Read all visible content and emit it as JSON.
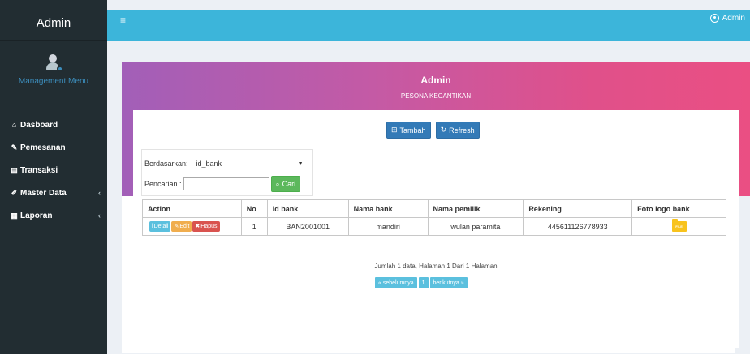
{
  "sidebar": {
    "brand": "Admin",
    "management_label": "Management Menu",
    "items": [
      {
        "icon": "home-icon",
        "glyph": "⌂",
        "label": "Dasboard",
        "chevron": ""
      },
      {
        "icon": "pencil-icon",
        "glyph": "✎",
        "label": "Pemesanan",
        "chevron": ""
      },
      {
        "icon": "book-icon",
        "glyph": "▤",
        "label": "Transaksi",
        "chevron": ""
      },
      {
        "icon": "edit-icon",
        "glyph": "✐",
        "label": "Master Data",
        "chevron": "‹"
      },
      {
        "icon": "calendar-icon",
        "glyph": "▦",
        "label": "Laporan",
        "chevron": "‹"
      }
    ]
  },
  "topbar": {
    "menu_glyph": "≡",
    "user_label": "Admin"
  },
  "banner": {
    "title": "Admin",
    "subtitle": "PESONA KECANTIKAN"
  },
  "toolbar": {
    "tambah_label": "Tambah",
    "refresh_label": "Refresh"
  },
  "search": {
    "by_label": "Berdasarkan:",
    "by_value": "id_bank",
    "query_label": "Pencarian :",
    "query_value": "",
    "cari_label": "Cari"
  },
  "table": {
    "headers": [
      "Action",
      "No",
      "Id bank",
      "Nama bank",
      "Nama pemilik",
      "Rekening",
      "Foto logo bank"
    ],
    "rows": [
      {
        "detail": "Detail",
        "edit": "Edit",
        "hapus": "Hapus",
        "no": "1",
        "id_bank": "BAN2001001",
        "nama_bank": "mandiri",
        "nama_pemilik": "wulan paramita",
        "rekening": "445611126778933",
        "logo_text": "FILE"
      }
    ]
  },
  "summary": "Jumlah 1 data, Halaman 1 Dari 1 Halaman",
  "pagination": {
    "prev": "« sebelumnya",
    "page": "1",
    "next": "berikutnya »"
  },
  "colors": {
    "sidebar": "#222d32",
    "topbar": "#3cb5da",
    "banner_start": "#a25fb8",
    "banner_end": "#ea4f83",
    "primary": "#337ab7",
    "success": "#5cb85c",
    "info": "#5bc0de"
  }
}
